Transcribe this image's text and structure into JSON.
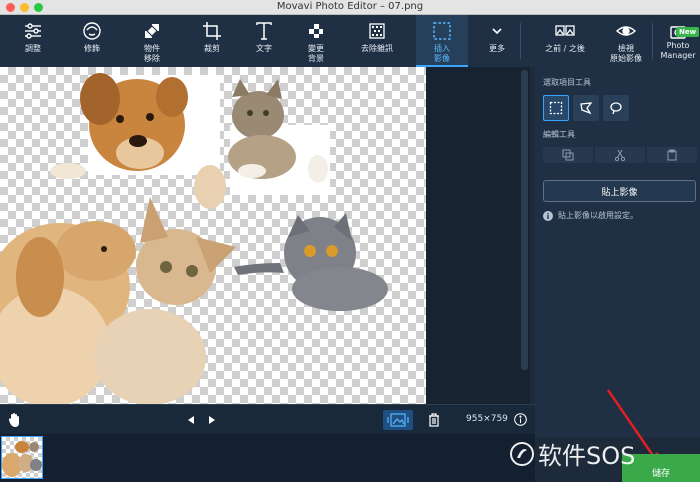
{
  "window": {
    "title": "Movavi Photo Editor – 07.png"
  },
  "toolbar": {
    "items": [
      {
        "label": "調整",
        "icon": "sliders-icon"
      },
      {
        "label": "修飾",
        "icon": "face-icon"
      },
      {
        "label": "物件\n移除",
        "icon": "eraser-icon"
      },
      {
        "label": "裁剪",
        "icon": "crop-icon"
      },
      {
        "label": "文字",
        "icon": "text-icon"
      },
      {
        "label": "變更\n背景",
        "icon": "background-icon"
      },
      {
        "label": "去除雜訊",
        "icon": "denoise-icon"
      },
      {
        "label": "插入\n影像",
        "icon": "insert-image-icon"
      },
      {
        "label": "更多",
        "icon": "chevron-down-icon"
      }
    ],
    "before_after": "之前 / 之後",
    "view_original": "檢視\n原始影像",
    "photo_manager": "Photo\nManager",
    "new_badge": "New"
  },
  "panel": {
    "select_tools": "選取項目工具",
    "edit_tools": "編輯工具",
    "paste_button": "貼上影像",
    "info_text": "貼上影像以啟用設定。"
  },
  "statusbar": {
    "dimensions": "955×759"
  },
  "save_button": "儲存",
  "watermark": "软件SOS"
}
